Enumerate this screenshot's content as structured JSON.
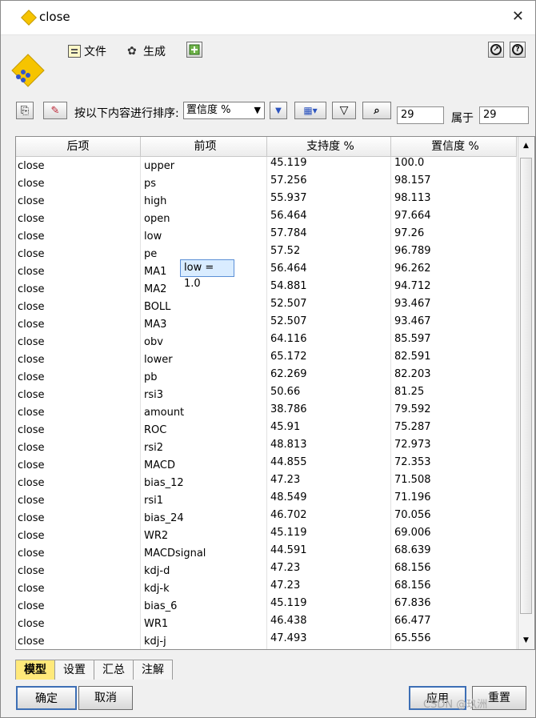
{
  "window": {
    "title": "close"
  },
  "menu": {
    "file_label": "文件",
    "generate_label": "生成"
  },
  "toolbar": {
    "sort_label": "按以下内容进行排序:",
    "sort_value": "置信度 %",
    "shown_count": "29",
    "of_label": "属于",
    "total_count": "29"
  },
  "table": {
    "columns": [
      "后项",
      "前项",
      "支持度 %",
      "置信度 %"
    ],
    "rows": [
      [
        "close",
        "upper",
        "45.119",
        "100.0"
      ],
      [
        "close",
        "ps",
        "57.256",
        "98.157"
      ],
      [
        "close",
        "high",
        "55.937",
        "98.113"
      ],
      [
        "close",
        "open",
        "56.464",
        "97.664"
      ],
      [
        "close",
        "low",
        "57.784",
        "97.26"
      ],
      [
        "close",
        "pe",
        "57.52",
        "96.789"
      ],
      [
        "close",
        "MA1",
        "56.464",
        "96.262"
      ],
      [
        "close",
        "MA2",
        "54.881",
        "94.712"
      ],
      [
        "close",
        "BOLL",
        "52.507",
        "93.467"
      ],
      [
        "close",
        "MA3",
        "52.507",
        "93.467"
      ],
      [
        "close",
        "obv",
        "64.116",
        "85.597"
      ],
      [
        "close",
        "lower",
        "65.172",
        "82.591"
      ],
      [
        "close",
        "pb",
        "62.269",
        "82.203"
      ],
      [
        "close",
        "rsi3",
        "50.66",
        "81.25"
      ],
      [
        "close",
        "amount",
        "38.786",
        "79.592"
      ],
      [
        "close",
        "ROC",
        "45.91",
        "75.287"
      ],
      [
        "close",
        "rsi2",
        "48.813",
        "72.973"
      ],
      [
        "close",
        "MACD",
        "44.855",
        "72.353"
      ],
      [
        "close",
        "bias_12",
        "47.23",
        "71.508"
      ],
      [
        "close",
        "rsi1",
        "48.549",
        "71.196"
      ],
      [
        "close",
        "bias_24",
        "46.702",
        "70.056"
      ],
      [
        "close",
        "WR2",
        "45.119",
        "69.006"
      ],
      [
        "close",
        "MACDsignal",
        "44.591",
        "68.639"
      ],
      [
        "close",
        "kdj-d",
        "47.23",
        "68.156"
      ],
      [
        "close",
        "kdj-k",
        "47.23",
        "68.156"
      ],
      [
        "close",
        "bias_6",
        "45.119",
        "67.836"
      ],
      [
        "close",
        "WR1",
        "46.438",
        "66.477"
      ],
      [
        "close",
        "kdj-j",
        "47.493",
        "65.556"
      ]
    ]
  },
  "tooltip": {
    "text": "low = 1.0"
  },
  "tabs": [
    "模型",
    "设置",
    "汇总",
    "注解"
  ],
  "buttons": {
    "ok": "确定",
    "cancel": "取消",
    "apply": "应用",
    "reset": "重置"
  },
  "watermark": "CSDN @玖洲",
  "colors": {
    "active_tab": "#ffe97a",
    "title_diamond": "#f6c400",
    "tooltip_bg": "#d9ecff"
  }
}
